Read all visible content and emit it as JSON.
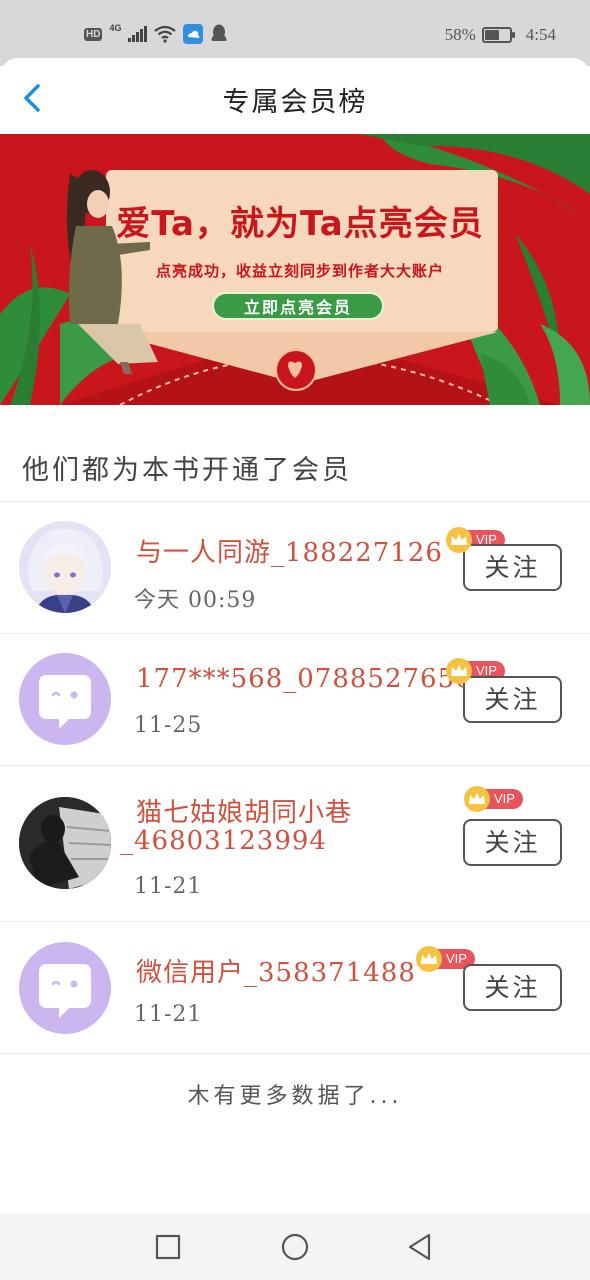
{
  "status_bar": {
    "hd": "HD",
    "network": "4G",
    "battery": "58%",
    "battery_level": 0.58,
    "time": "4:54"
  },
  "header": {
    "title": "专属会员榜",
    "back_icon": "chevron-left-icon"
  },
  "banner": {
    "headline": "爱Ta，就为Ta点亮会员",
    "subtitle": "点亮成功，收益立刻同步到作者大大账户",
    "button_label": "立即点亮会员",
    "colors": {
      "background": "#c9161c",
      "card": "#f8d8bd",
      "button": "#3a9a45",
      "leaf": "#2f8c3a"
    }
  },
  "section": {
    "title": "他们都为本书开通了会员"
  },
  "members": [
    {
      "name": "与一人同游_188227126",
      "date": "今天  00:59",
      "avatar": "anime-avatar",
      "badge": "VIP",
      "follow_label": "关注"
    },
    {
      "name": "177***568_0788527656",
      "date": "11-25",
      "avatar": "default-avatar",
      "badge": "VIP",
      "follow_label": "关注"
    },
    {
      "name_line1": "猫七姑娘胡同小巷",
      "name_line2": "_46803123994",
      "date": "11-21",
      "avatar": "photo-avatar",
      "badge": "VIP",
      "follow_label": "关注"
    },
    {
      "name": "微信用户_358371488",
      "date": "11-21",
      "avatar": "default-avatar",
      "badge": "VIP",
      "follow_label": "关注"
    }
  ],
  "footer": {
    "no_more": "木有更多数据了..."
  },
  "nav": {
    "recent_icon": "square-icon",
    "home_icon": "circle-icon",
    "back_icon": "triangle-back-icon"
  },
  "colors": {
    "name_red": "#d2503e",
    "vip_pink": "#e8545b",
    "crown_gold": "#f5c242",
    "default_avatar": "#ccb6ef",
    "accent_blue": "#1a8fe8"
  }
}
